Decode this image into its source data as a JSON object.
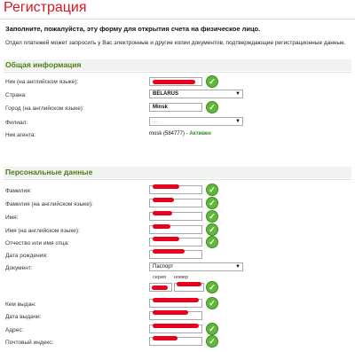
{
  "page": {
    "title": "Регистрация",
    "intro": "Заполните, пожалуйста, эту форму для открытия счета на физическое лицо.",
    "note": "Отдел платежей может запросить у Вас электронные и другие копии документов, подтверждающие регистрационные данные."
  },
  "general": {
    "heading": "Общая информация",
    "fields": {
      "nick_label": "Ник (на английском языке):",
      "country_label": "Страна:",
      "country_value": "BELARUS",
      "city_label": "Город (на английском языке):",
      "city_value": "Minsk",
      "branch_label": "Филиал:",
      "branch_value": "...",
      "agent_label": "Ник агента:",
      "agent_value": "mosk (584777) - ",
      "agent_status": "Активен"
    }
  },
  "personal": {
    "heading": "Персональные данные",
    "fields": {
      "surname_label": "Фамилия:",
      "surname_en_label": "Фамилия (на английском языке):",
      "name_label": "Имя:",
      "name_en_label": "Имя (на английском языке):",
      "patronymic_label": "Отчество или имя отца:",
      "birthdate_label": "Дата рождения:",
      "document_label": "Документ:",
      "document_value": "Паспорт",
      "series_label": "серия",
      "number_label": "номер",
      "issued_by_label": "Кем выдан:",
      "issue_date_label": "Дата выдачи:",
      "address_label": "Адрес:",
      "postcode_label": "Почтовый индекс:"
    }
  },
  "icons": {
    "valid": "check-circle-icon",
    "dropdown": "chevron-down-icon"
  },
  "colors": {
    "title": "#d6181f",
    "section_heading": "#4e7d12",
    "status_active": "#2f8a25",
    "check": "#5fb838",
    "redaction": "#e8001c"
  }
}
